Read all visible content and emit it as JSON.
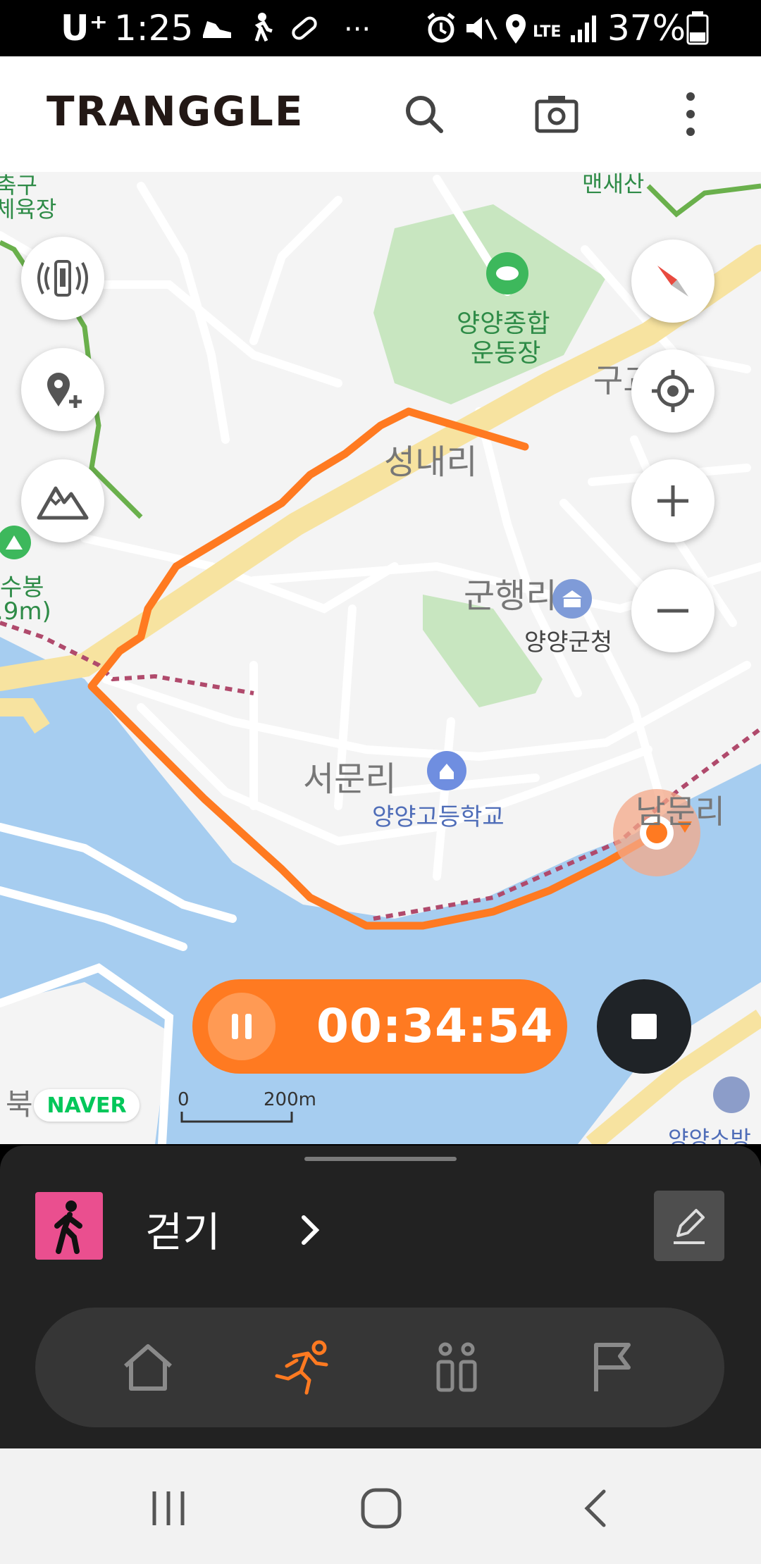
{
  "status_bar": {
    "carrier": "U⁺",
    "time": "1:25",
    "more": "···",
    "network": "LTE",
    "battery": "37%"
  },
  "header": {
    "logo": "TRANGGLE",
    "icons": [
      "search-icon",
      "camera-icon",
      "more-vert-icon"
    ]
  },
  "map": {
    "labels": {
      "stadium_line1": "양양종합",
      "stadium_line2": "운동장",
      "seongnae": "성내리",
      "gunhaeng": "군행리",
      "county_office": "양양군청",
      "seomun": "서문리",
      "highschool": "양양고등학교",
      "nammun": "남문리",
      "gugyo": "구교",
      "maemsan": "맨새산",
      "gym_partial_1": "축구",
      "gym_partial_2": "체육장",
      "peak_name": "수봉",
      "peak_height": ".9m)",
      "north_partial": "북",
      "fire_station_partial": "양양소방"
    },
    "naver": "NAVER",
    "scale_zero": "0",
    "scale_distance": "200m",
    "route_color": "#ff7a21",
    "left_controls": [
      "signal-icon",
      "add-location-icon",
      "mountain-icon"
    ],
    "right_controls": [
      "compass-icon",
      "my-location-icon",
      "zoom-in-icon",
      "zoom-out-icon"
    ]
  },
  "timer": {
    "elapsed": "00:34:54",
    "state": "recording"
  },
  "sheet": {
    "activity": "걷기",
    "activity_color": "#ea4f8f",
    "tabs": [
      "home-icon",
      "running-icon",
      "people-icon",
      "flag-icon"
    ],
    "active_tab": "running-icon"
  },
  "nav": [
    "recent-apps-icon",
    "home-circle-icon",
    "back-icon"
  ]
}
